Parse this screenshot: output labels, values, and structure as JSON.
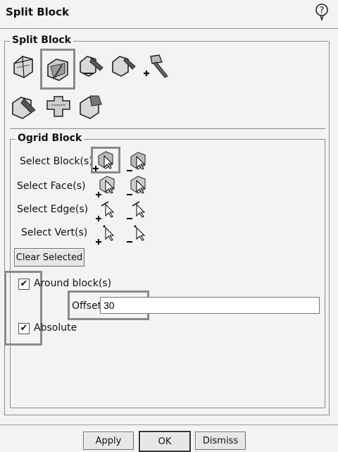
{
  "window": {
    "title": "Split Block"
  },
  "split_group": {
    "legend": "Split Block",
    "tools": [
      {
        "icon": "split-block-icon"
      },
      {
        "icon": "split-block-prescribed-icon"
      },
      {
        "icon": "split-block-edge-icon"
      },
      {
        "icon": "split-block-vertex-icon"
      },
      {
        "icon": "split-block-axe-icon"
      },
      {
        "icon": "split-block-face-icon"
      },
      {
        "icon": "split-block-merge-icon"
      },
      {
        "icon": "split-block-extend-icon"
      }
    ]
  },
  "ogrid_group": {
    "legend": "Ogrid Block",
    "rows": [
      {
        "label": "Select Block(s)"
      },
      {
        "label": "Select Face(s)"
      },
      {
        "label": "Select Edge(s)"
      },
      {
        "label": "Select Vert(s)"
      }
    ],
    "clear_label": "Clear Selected",
    "around_label": "Around block(s)",
    "around_checked": true,
    "offset_label": "Offset",
    "offset_value": "30",
    "absolute_label": "Absolute",
    "absolute_checked": true
  },
  "footer": {
    "apply": "Apply",
    "ok": "OK",
    "dismiss": "Dismiss"
  }
}
